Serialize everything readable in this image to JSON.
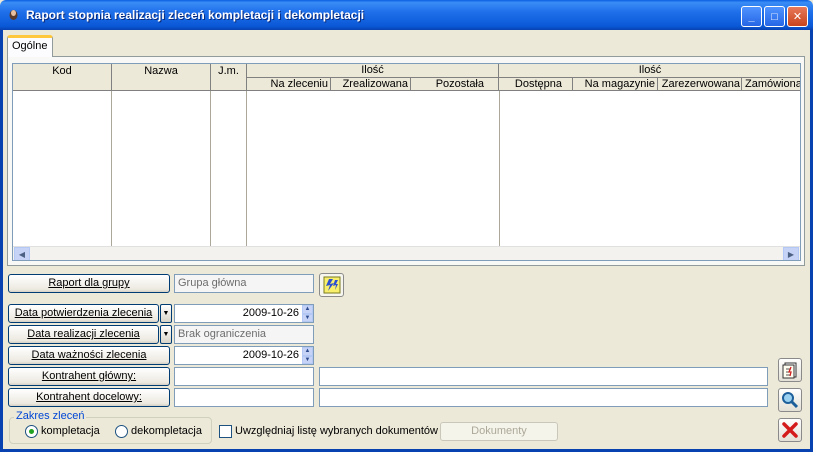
{
  "window": {
    "title": "Raport stopnia realizacji zleceń kompletacji i dekompletacji",
    "minimize": "_",
    "maximize": "□",
    "close": "✕"
  },
  "tabs": [
    {
      "label": "Ogólne",
      "active": true
    }
  ],
  "grid": {
    "columns": {
      "kod": "Kod",
      "nazwa": "Nazwa",
      "jm": "J.m.",
      "ilosc1": "Ilość",
      "ilosc2": "Ilość",
      "na_zleceniu": "Na zleceniu",
      "zrealizowana": "Zrealizowana",
      "pozostala": "Pozostała",
      "dostepna": "Dostępna",
      "na_magazynie": "Na magazynie",
      "zarezerwowana": "Zarezerwowana",
      "zamowiona": "Zamówiona"
    },
    "rows": [],
    "scroll_left": "◀",
    "scroll_right": "▶"
  },
  "form": {
    "raport_button": "Raport dla grupy",
    "raport_value": "Grupa główna",
    "data_potw_button": "Data potwierdzenia zlecenia",
    "data_potw_value": "2009-10-26",
    "data_real_button": "Data realizacji zlecenia",
    "data_real_value": "Brak ograniczenia",
    "data_wazn_button": "Data ważności zlecenia",
    "data_wazn_value": "2009-10-26",
    "kontr_glowny_button": "Kontrahent główny:",
    "kontr_glowny_code": "",
    "kontr_glowny_name": "",
    "kontr_docelowy_button": "Kontrahent docelowy:",
    "kontr_docelowy_code": "",
    "kontr_docelowy_name": ""
  },
  "zakres": {
    "label": "Zakres zleceń",
    "kompletacja": "kompletacja",
    "dekompletacja": "dekompletacja",
    "selected": "kompletacja"
  },
  "uwzgledniaj": {
    "label": "Uwzględniaj listę wybranych dokumentów",
    "checked": false
  },
  "dokumenty_button": "Dokumenty",
  "colors": {
    "titlebar": "#0a58d6",
    "accent_tab": "#ffc83c",
    "window_bg": "#ece9d8"
  }
}
